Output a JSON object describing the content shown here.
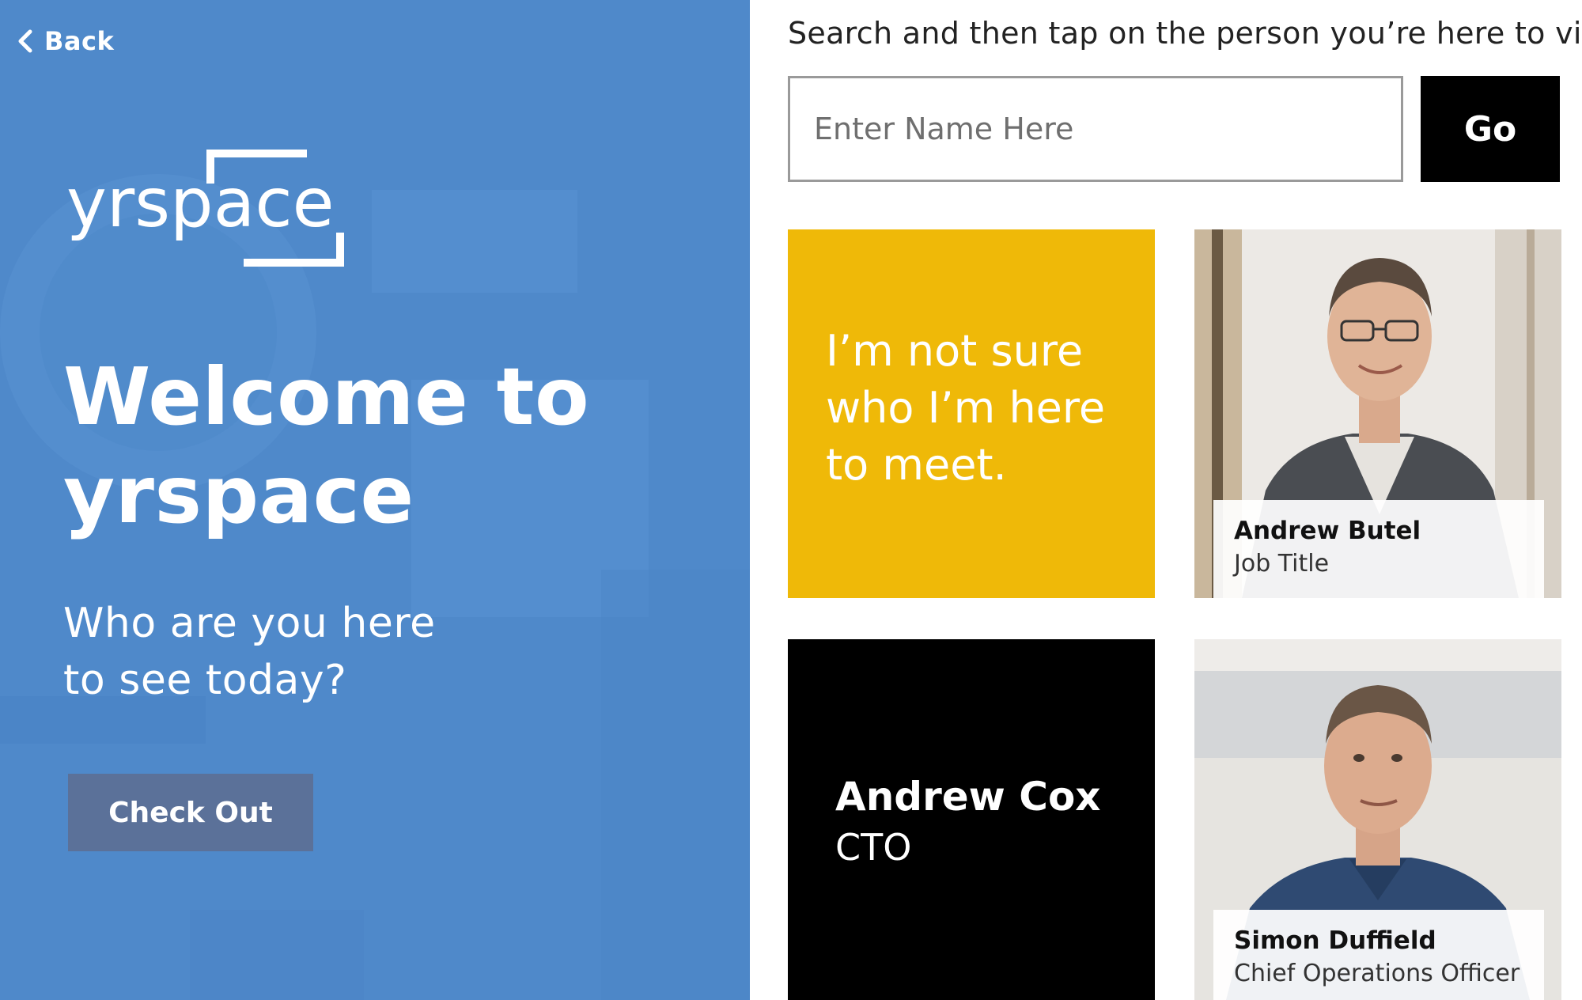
{
  "nav": {
    "back_label": "Back"
  },
  "brand": {
    "logo_text": "yrspace"
  },
  "welcome": {
    "line1": "Welcome to",
    "line2": "yrspace",
    "subtitle_line1": "Who are you here",
    "subtitle_line2": "to see today?"
  },
  "actions": {
    "checkout_label": "Check Out"
  },
  "search": {
    "instructions": "Search and then tap on the person you’re here to visit",
    "placeholder": "Enter Name Here",
    "value": "",
    "go_label": "Go"
  },
  "tiles": {
    "unsure": {
      "line1": "I’m not sure",
      "line2": "who I’m here",
      "line3": "to meet."
    },
    "people": [
      {
        "name": "Andrew Butel",
        "title": "Job Title"
      },
      {
        "name": "Andrew Cox",
        "title": "CTO"
      },
      {
        "name": "Simon Duffield",
        "title": "Chief Operations Officer"
      }
    ]
  },
  "colors": {
    "left_panel": "#4f89ca",
    "checkout_button": "#5b7199",
    "unsure_tile": "#efb908",
    "dark_tile": "#000000",
    "go_button": "#000000"
  }
}
